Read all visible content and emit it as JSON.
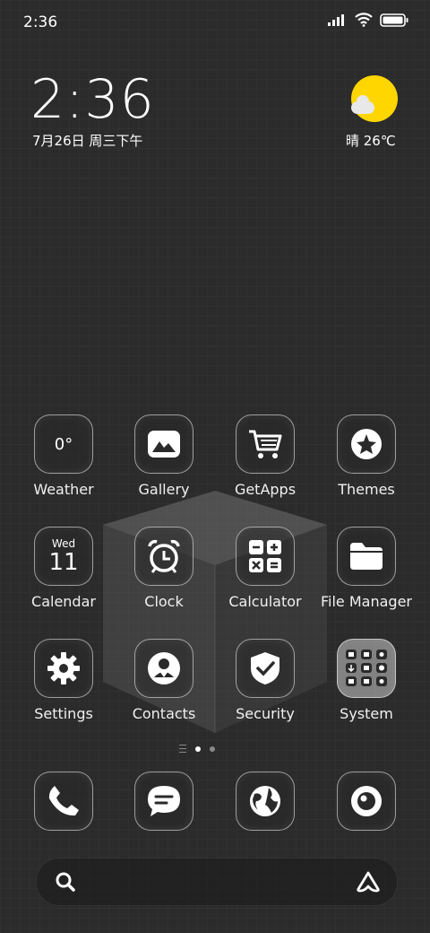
{
  "status_bar": {
    "time": "2:36"
  },
  "lock_widget": {
    "time": "2:36",
    "date": "7月26日 周三下午",
    "weather": "晴 26℃"
  },
  "apps": [
    {
      "label": "Weather",
      "icon": "weather-icon",
      "icon_text": "0°"
    },
    {
      "label": "Gallery",
      "icon": "gallery-icon"
    },
    {
      "label": "GetApps",
      "icon": "cart-icon"
    },
    {
      "label": "Themes",
      "icon": "themes-icon"
    },
    {
      "label": "Calendar",
      "icon": "calendar-icon",
      "day": "Wed",
      "date": "11"
    },
    {
      "label": "Clock",
      "icon": "alarm-clock-icon"
    },
    {
      "label": "Calculator",
      "icon": "calculator-icon"
    },
    {
      "label": "File Manager",
      "icon": "folder-icon"
    },
    {
      "label": "Settings",
      "icon": "gear-icon"
    },
    {
      "label": "Contacts",
      "icon": "contacts-icon"
    },
    {
      "label": "Security",
      "icon": "shield-icon"
    },
    {
      "label": "System",
      "icon": "system-folder-icon"
    }
  ],
  "page_indicator": {
    "current": 1,
    "total": 2
  },
  "dock": [
    {
      "name": "phone",
      "icon": "phone-icon"
    },
    {
      "name": "messages",
      "icon": "chat-icon"
    },
    {
      "name": "browser",
      "icon": "globe-icon"
    },
    {
      "name": "camera",
      "icon": "camera-icon"
    }
  ],
  "search_bar": {
    "icon": "search-icon",
    "assistant_icon": "assistant-icon"
  },
  "colors": {
    "sun": "#ffd600",
    "background": "#2b2b2b"
  }
}
